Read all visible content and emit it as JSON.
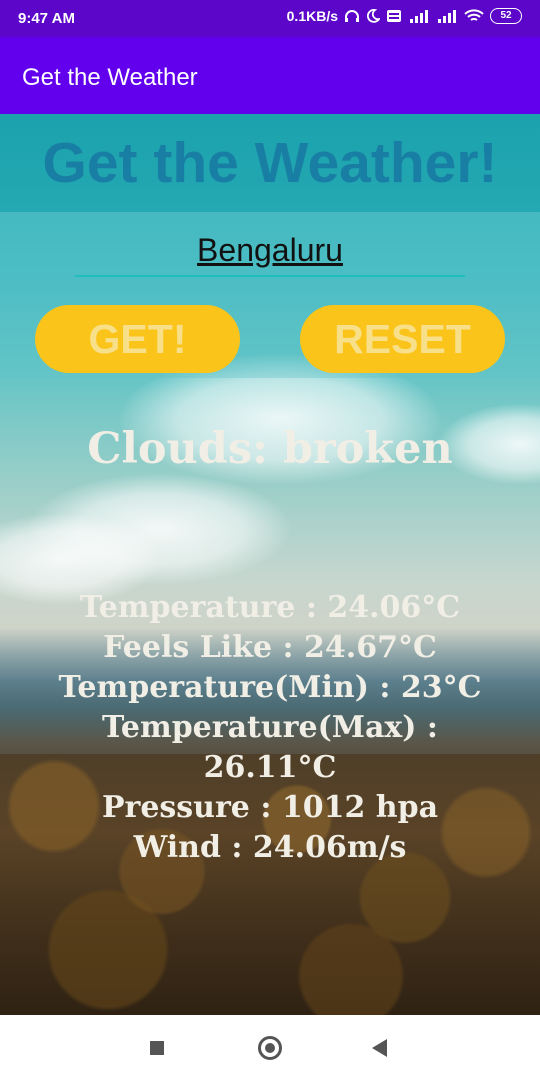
{
  "status_bar": {
    "time": "9:47 AM",
    "network_speed": "0.1KB/s",
    "battery": "52",
    "icons": [
      "headphones-icon",
      "moon-icon",
      "volte-icon",
      "signal-icon",
      "signal-icon",
      "wifi-icon",
      "battery-icon"
    ]
  },
  "app_bar": {
    "title": "Get the Weather"
  },
  "header": {
    "title": "Get the Weather!"
  },
  "form": {
    "city_value": "Bengaluru",
    "get_label": "GET!",
    "reset_label": "RESET"
  },
  "weather": {
    "clouds": "Clouds: broken",
    "temperature": "Temperature : 24.06°C",
    "feels_like": "Feels Like : 24.67°C",
    "temp_min": "Temperature(Min) : 23°C",
    "temp_max": "Temperature(Max) :\n26.11°C",
    "pressure": "Pressure : 1012 hpa",
    "wind": "Wind : 24.06m/s"
  },
  "colors": {
    "status_bar": "#5b06c9",
    "app_bar": "#6200ee",
    "button": "#fbc41a",
    "title_text": "#1878a3"
  },
  "nav_bar": {
    "icons": [
      "recents-icon",
      "home-icon",
      "back-icon"
    ]
  }
}
